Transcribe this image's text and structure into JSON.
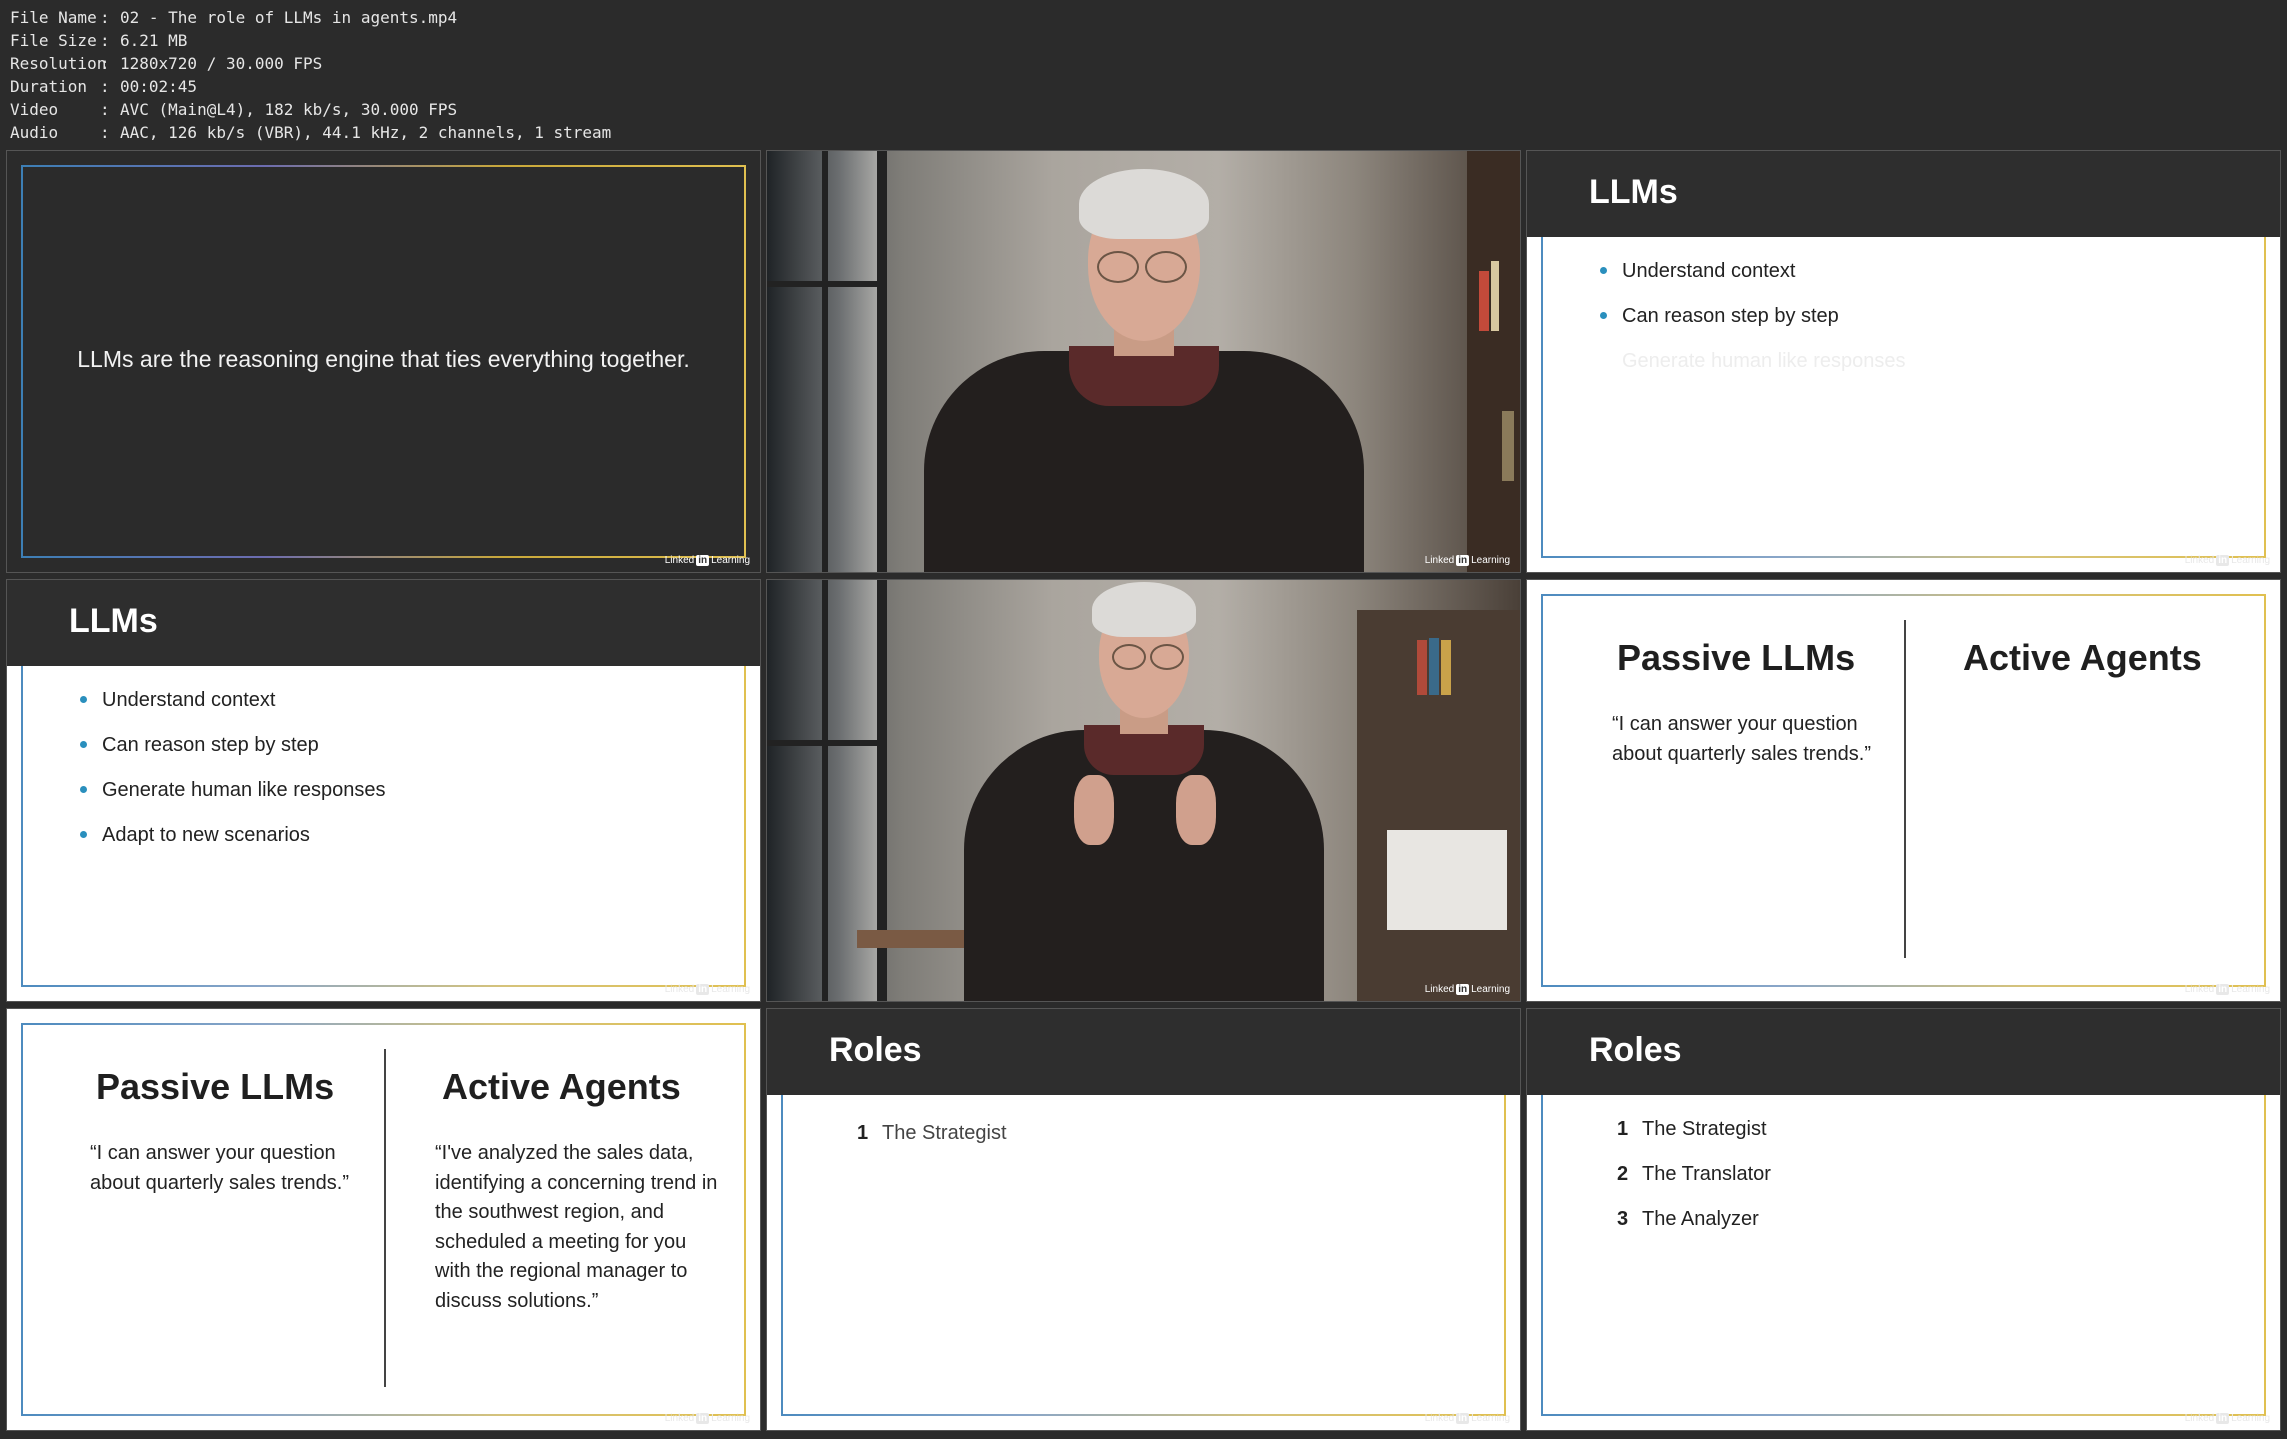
{
  "metadata": [
    {
      "key": "File Name",
      "value": "02 - The role of LLMs in agents.mp4"
    },
    {
      "key": "File Size",
      "value": "6.21 MB"
    },
    {
      "key": "Resolution",
      "value": "1280x720 / 30.000 FPS"
    },
    {
      "key": "Duration",
      "value": "00:02:45"
    },
    {
      "key": "Video",
      "value": "AVC (Main@L4), 182 kb/s, 30.000 FPS"
    },
    {
      "key": "Audio",
      "value": "AAC, 126 kb/s (VBR), 44.1 kHz, 2 channels, 1 stream"
    }
  ],
  "watermark": {
    "pre": "Linked",
    "in": "in",
    "post": "Learning"
  },
  "frame1": {
    "quote": "LLMs are the reasoning engine that ties everything together."
  },
  "frame3": {
    "title": "LLMs",
    "bullets": [
      "Understand context",
      "Can reason step by step"
    ],
    "faded_bullet": "Generate human like responses"
  },
  "frame4": {
    "title": "LLMs",
    "bullets": [
      "Understand context",
      "Can reason step by step",
      "Generate human like responses",
      "Adapt to new scenarios"
    ]
  },
  "frame6": {
    "left_title": "Passive LLMs",
    "left_text": "“I can answer your question about quarterly sales trends.”",
    "right_title": "Active Agents"
  },
  "frame7": {
    "left_title": "Passive LLMs",
    "left_text": "“I can answer your question about quarterly sales trends.”",
    "right_title": "Active Agents",
    "right_text": "“I've analyzed the sales data, identifying a concerning trend in the southwest region, and scheduled a meeting for you with the regional manager to discuss solutions.”"
  },
  "frame8": {
    "title": "Roles",
    "items": [
      {
        "num": "1",
        "label": "The Strategist"
      }
    ]
  },
  "frame9": {
    "title": "Roles",
    "items": [
      {
        "num": "1",
        "label": "The Strategist"
      },
      {
        "num": "2",
        "label": "The Translator"
      },
      {
        "num": "3",
        "label": "The Analyzer"
      }
    ]
  }
}
